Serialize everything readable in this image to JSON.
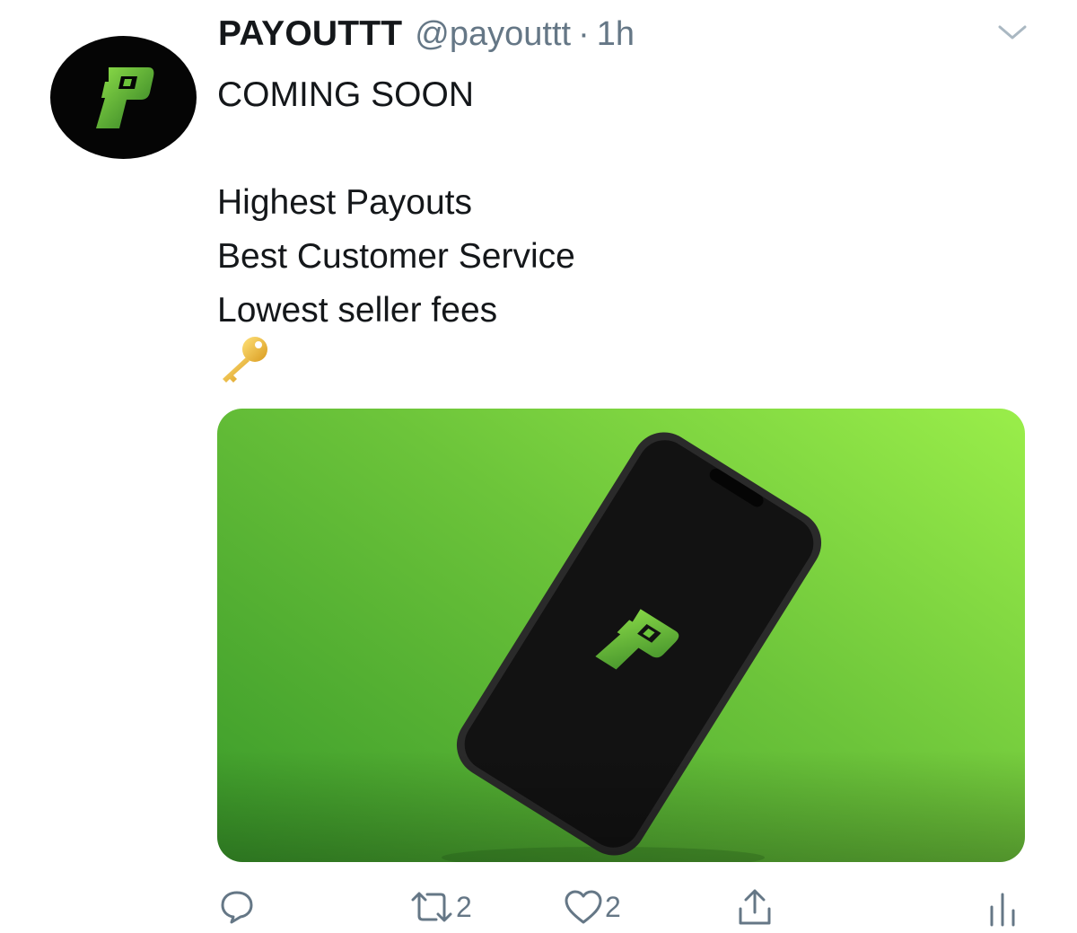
{
  "tweet": {
    "author_name": "PAYOUTTT",
    "handle": "@payouttt",
    "separator": "·",
    "timestamp": "1h",
    "text_lines": [
      "COMING SOON",
      "",
      "Highest Payouts",
      "Best Customer Service",
      "Lowest seller fees"
    ],
    "emoji": "key-emoji"
  },
  "actions": {
    "reply_count": "",
    "retweet_count": "2",
    "like_count": "2"
  },
  "colors": {
    "logo_green": "#6cc43a",
    "secondary_text": "#657786",
    "media_gradient_light": "#9aee4a",
    "media_gradient_dark": "#3a9a2a"
  }
}
